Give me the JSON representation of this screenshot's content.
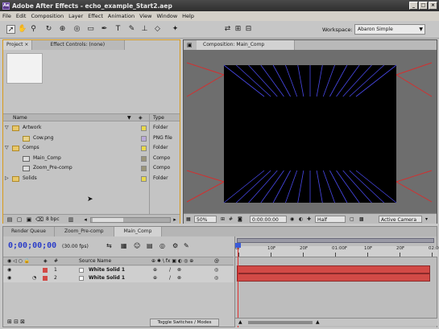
{
  "window": {
    "title": "Adobe After Effects - echo_example_Start2.aep",
    "controls": [
      "_",
      "□",
      "×"
    ]
  },
  "menu": [
    "File",
    "Edit",
    "Composition",
    "Layer",
    "Effect",
    "Animation",
    "View",
    "Window",
    "Help"
  ],
  "toolbar": {
    "tools": [
      "selection-tool",
      "hand-tool",
      "zoom-tool",
      "rotate-tool",
      "orbit-camera-tool",
      "pan-behind-tool",
      "mask-tool",
      "pen-tool",
      "text-tool",
      "brush-tool",
      "clone-stamp-tool",
      "eraser-tool",
      "puppet-tool"
    ],
    "workspace_label": "Workspace:",
    "workspace_value": "Abaron Simple"
  },
  "project_panel": {
    "tabs": [
      "Project ×",
      "Effect Controls: (none)"
    ],
    "columns": {
      "name": "Name",
      "type": "Type"
    },
    "items": [
      {
        "name": "Artwork",
        "type": "Folder",
        "kind": "folder",
        "expanded": true,
        "indent": 0,
        "label_color": "#e8d84a"
      },
      {
        "name": "Cow.png",
        "type": "PNG file",
        "kind": "file",
        "indent": 1,
        "label_color": "#b8a8d8"
      },
      {
        "name": "Comps",
        "type": "Folder",
        "kind": "folder",
        "expanded": true,
        "indent": 0,
        "label_color": "#e8d84a"
      },
      {
        "name": "Main_Comp",
        "type": "Compo",
        "kind": "comp",
        "indent": 1,
        "label_color": "#9a9478"
      },
      {
        "name": "Zoom_Pre-comp",
        "type": "Compo",
        "kind": "comp",
        "indent": 1,
        "label_color": "#9a9478"
      },
      {
        "name": "Solids",
        "type": "Folder",
        "kind": "folder",
        "expanded": false,
        "indent": 0,
        "label_color": "#e8d84a"
      }
    ],
    "footer": {
      "bpc": "8 bpc"
    }
  },
  "comp_panel": {
    "tab": "Composition: Main_Comp",
    "footer": {
      "zoom": "50%",
      "timecode": "0:00:00:00",
      "resolution": "Half",
      "view": "Active Camera"
    },
    "colors": {
      "lines": "#4848e8",
      "frame": "#d23030",
      "bg": "#000000"
    }
  },
  "timeline": {
    "tabs": [
      "Render Queue",
      "Zoom_Pre-comp",
      "Main_Comp"
    ],
    "timecode": "0;00;00;00",
    "fps": "(30.00 fps)",
    "columns": {
      "num": "#",
      "source": "Source Name"
    },
    "layers": [
      {
        "num": "1",
        "name": "White Solid 1",
        "color": "#d24a46"
      },
      {
        "num": "2",
        "name": "White Solid 1",
        "color": "#d24a46"
      }
    ],
    "ruler": [
      "0F",
      "10F",
      "20F",
      "01:00F",
      "10F",
      "20F",
      "02:00"
    ],
    "toggle_label": "Toggle Switches / Modes"
  }
}
